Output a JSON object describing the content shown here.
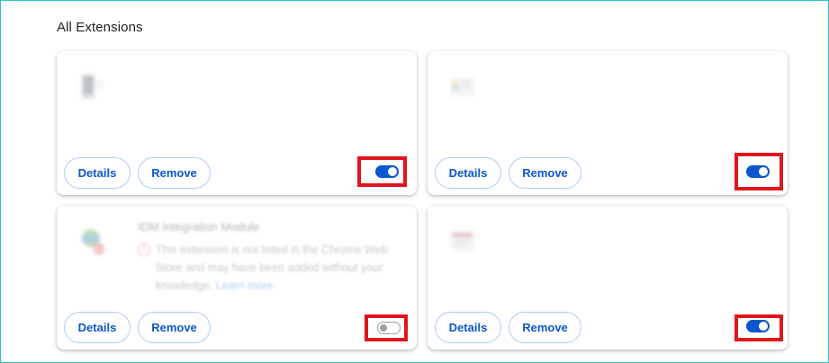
{
  "section": {
    "title": "All Extensions"
  },
  "buttons": {
    "details_label": "Details",
    "remove_label": "Remove"
  },
  "extensions": [
    {
      "name": "",
      "description": "",
      "enabled": true,
      "icon": "extension-icon"
    },
    {
      "name": "",
      "description": "",
      "enabled": true,
      "icon": "extension-icon"
    },
    {
      "name": "IDM Integration Module",
      "warning": "This extension is not listed in the Chrome Web Store and may have been added without your knowledge.",
      "learn_more": "Learn more",
      "enabled": false,
      "icon": "idm-icon"
    },
    {
      "name": "",
      "description": "",
      "enabled": true,
      "icon": "extension-icon"
    }
  ],
  "colors": {
    "accent": "#0b57d0",
    "highlight": "#e1141e",
    "toggle_off": "#9aa0a6",
    "frame_border": "#2fc2c2"
  }
}
